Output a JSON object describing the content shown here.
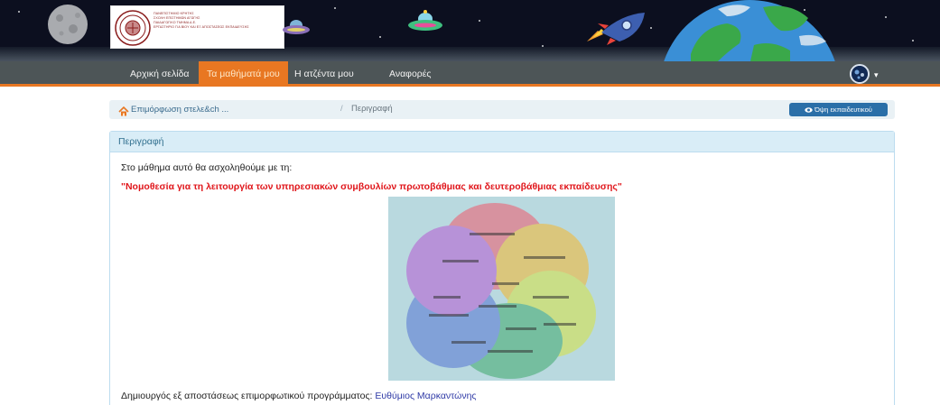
{
  "header": {
    "logo_lines": [
      "ΠΑΝΕΠΙΣΤΗΜΙΟ ΚΡΗΤΗΣ",
      "ΣΧΟΛΗ ΕΠΙΣΤΗΜΩΝ ΑΓΩΓΗΣ",
      "ΠΑΙΔΑΓΩΓΙΚΟ ΤΜΗΜΑ Δ.Ε.",
      "ΕΡΓΑΣΤΗΡΙΟ ΓΙΑ ΒΙΟΥ ΚΑΙ ΕΞ ΑΠΟΣΤΑΣΕΩΣ ΕΚΠΑΙΔΕΥΣΗΣ"
    ]
  },
  "nav": {
    "items": [
      {
        "label": "Αρχική σελίδα",
        "active": false
      },
      {
        "label": "Τα μαθήματά μου",
        "active": true
      },
      {
        "label": "Η ατζέντα μου",
        "active": false
      },
      {
        "label": "Αναφορές",
        "active": false
      }
    ],
    "caret": "▾"
  },
  "breadcrumb": {
    "course": "Επιμόρφωση στελε&ch ...",
    "separator": "/",
    "current": "Περιγραφή",
    "teacher_view_label": "Όψη εκπαιδευτικού"
  },
  "panel": {
    "heading": "Περιγραφή",
    "intro": "Στο μάθημα αυτό θα ασχοληθούμε με τη:",
    "title": "\"Νομοθεσία για τη λειτουργία των υπηρεσιακών συμβουλίων πρωτοβάθμιας και δευτεροβάθμιας εκπαίδευσης\"",
    "creator_prefix": "Δημιουργός εξ αποστάσεως επιμορφωτικού προγράμματος:",
    "creator_name": "Ευθύμιος Μαρκαντώνης"
  },
  "colors": {
    "accent": "#e87722",
    "navbar": "#4d5557",
    "panel_heading_bg": "#d9edf7",
    "button": "#2a6fa8",
    "title_red": "#e0161b"
  },
  "icons": [
    "moon-icon",
    "ufo-icon",
    "rocket-icon",
    "earth-icon",
    "home-icon",
    "eye-icon",
    "avatar",
    "caret-down-icon"
  ]
}
